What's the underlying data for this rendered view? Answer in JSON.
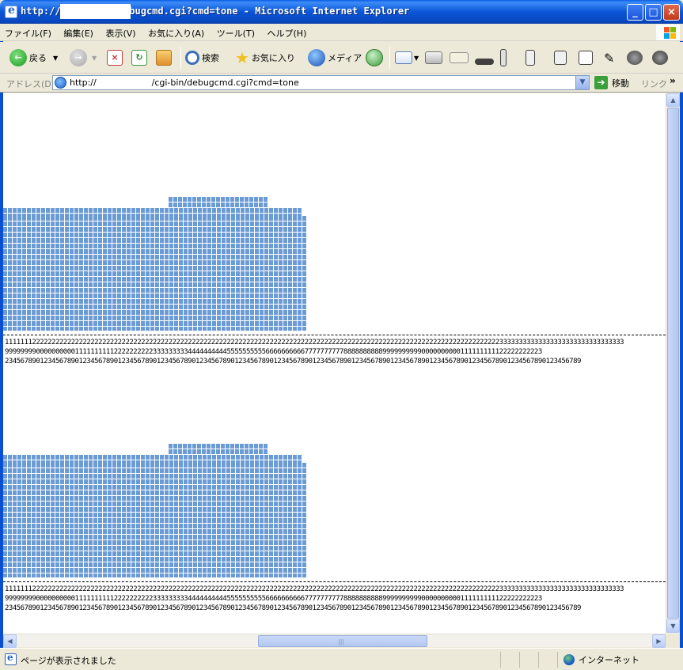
{
  "window": {
    "title": "http://                   /cgi-bin/debugcmd.cgi?cmd=tone - Microsoft Internet Explorer"
  },
  "menu": [
    "ファイル(F)",
    "編集(E)",
    "表示(V)",
    "お気に入り(A)",
    "ツール(T)",
    "ヘルプ(H)"
  ],
  "toolbar": {
    "back": "戻る",
    "search": "検索",
    "favorites": "お気に入り",
    "media": "メディア"
  },
  "address": {
    "label": "アドレス(D)",
    "url": "http://                    /cgi-bin/debugcmd.cgi?cmd=tone",
    "go": "移動",
    "links": "リンク"
  },
  "content": {
    "row1": "111111122222222222222222222222222222222222222222222222222222222222222222222222222222222222222222222222222222222222222222222222233333333333333333333333333333333",
    "row2": "999999990000000000111111111122222222223333333334444444444555555555566666666667777777777888888888899999999990000000000111111111122222222223",
    "row3": "2345678901234567890123456789012345678901234567890123456789012345678901234567890123456789012345678901234567890123456789012345678901234567890123456789"
  },
  "status": {
    "text": "ページが表示されました",
    "zone": "インターネット"
  }
}
